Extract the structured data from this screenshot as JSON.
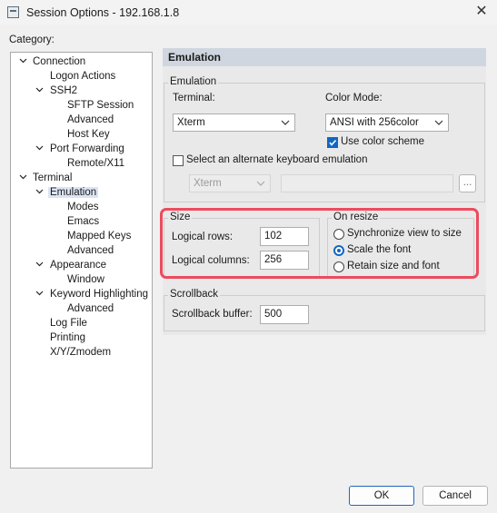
{
  "window": {
    "title": "Session Options - 192.168.1.8"
  },
  "category_label": "Category:",
  "tree": [
    {
      "label": "Connection"
    },
    {
      "label": "Logon Actions"
    },
    {
      "label": "SSH2"
    },
    {
      "label": "SFTP Session"
    },
    {
      "label": "Advanced"
    },
    {
      "label": "Host Key"
    },
    {
      "label": "Port Forwarding"
    },
    {
      "label": "Remote/X11"
    },
    {
      "label": "Terminal"
    },
    {
      "label": "Emulation"
    },
    {
      "label": "Modes"
    },
    {
      "label": "Emacs"
    },
    {
      "label": "Mapped Keys"
    },
    {
      "label": "Advanced"
    },
    {
      "label": "Appearance"
    },
    {
      "label": "Window"
    },
    {
      "label": "Keyword Highlighting"
    },
    {
      "label": "Advanced"
    },
    {
      "label": "Log File"
    },
    {
      "label": "Printing"
    },
    {
      "label": "X/Y/Zmodem"
    }
  ],
  "page": {
    "header": "Emulation",
    "emulation_group": {
      "label": "Emulation",
      "terminal_label": "Terminal:",
      "terminal_value": "Xterm",
      "color_mode_label": "Color Mode:",
      "color_mode_value": "ANSI with 256color",
      "use_color_scheme": "Use color scheme",
      "use_color_scheme_checked": true,
      "alt_keyboard": "Select an alternate keyboard emulation",
      "alt_keyboard_checked": false,
      "alt_keyboard_value": "Xterm",
      "browse": "..."
    },
    "size_group": {
      "label": "Size",
      "rows_label": "Logical rows:",
      "rows_value": "102",
      "cols_label": "Logical columns:",
      "cols_value": "256"
    },
    "on_resize_group": {
      "label": "On resize",
      "options": [
        "Synchronize view to size",
        "Scale the font",
        "Retain size and font"
      ],
      "selected": "Scale the font"
    },
    "scrollback_group": {
      "label": "Scrollback",
      "buffer_label": "Scrollback buffer:",
      "buffer_value": "500"
    }
  },
  "buttons": {
    "ok": "OK",
    "cancel": "Cancel"
  },
  "colors": {
    "highlight": "#ec4b5e",
    "accent": "#1067c4",
    "header_bar": "#cfd6df"
  },
  "icons": [
    "app-icon",
    "close-icon",
    "caret-down-icon",
    "chevron-down-icon",
    "checkmark-icon"
  ]
}
